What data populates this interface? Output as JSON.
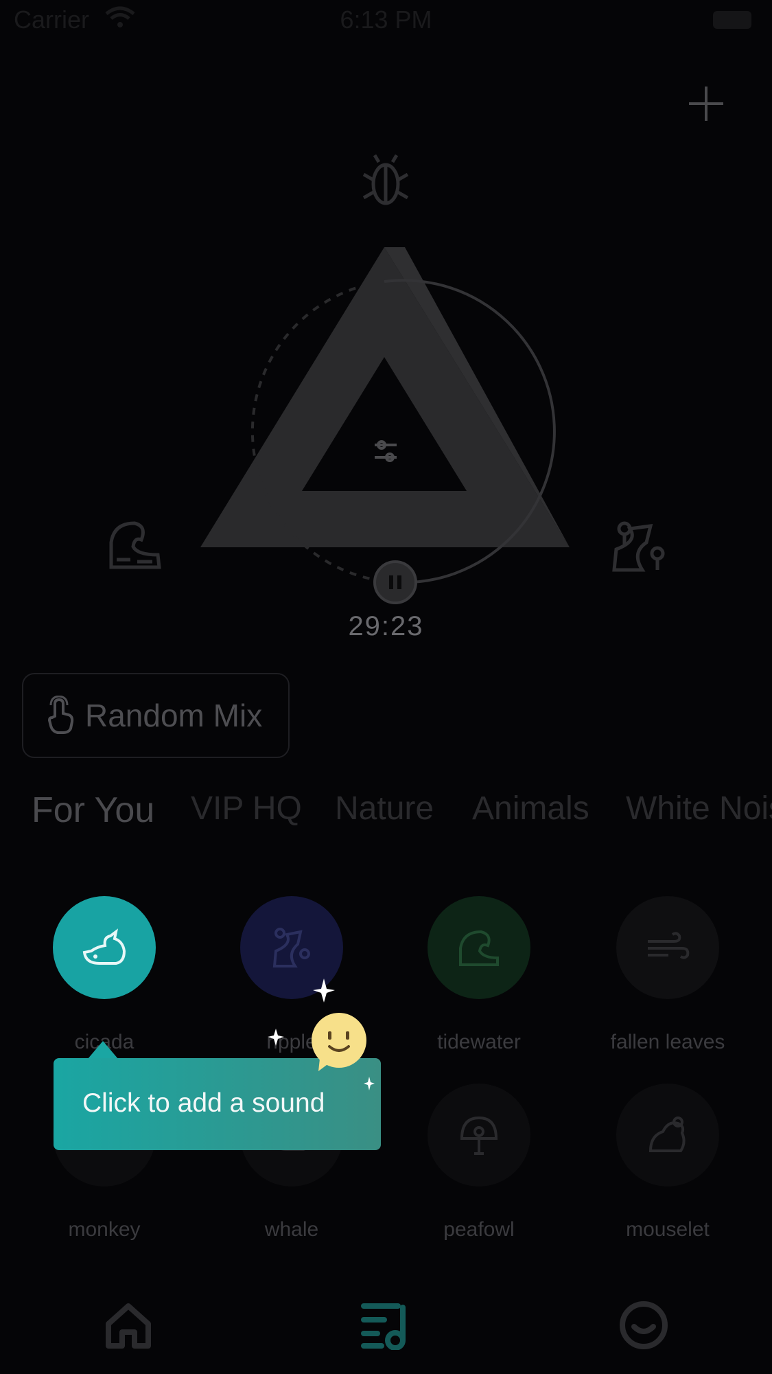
{
  "status_bar": {
    "carrier": "Carrier",
    "time": "6:13 PM"
  },
  "player": {
    "timer": "29:23"
  },
  "random_mix": {
    "label": "Random Mix"
  },
  "tabs": [
    {
      "label": "For You",
      "active": true
    },
    {
      "label": "VIP HQ"
    },
    {
      "label": "Nature"
    },
    {
      "label": "Animals"
    },
    {
      "label": "White Nois"
    }
  ],
  "sounds_row1": [
    {
      "label": "cicada",
      "icon": "whale-icon",
      "color": "#18a3a3"
    },
    {
      "label": "ripple",
      "icon": "ripple-icon",
      "color": "#14163a"
    },
    {
      "label": "tidewater",
      "icon": "wave-icon",
      "color": "#0d2416"
    },
    {
      "label": "fallen leaves",
      "icon": "wind-icon",
      "color": "#0f0f11"
    }
  ],
  "sounds_row2": [
    {
      "label": "monkey",
      "icon": "monkey-icon"
    },
    {
      "label": "whale",
      "icon": "whale-icon"
    },
    {
      "label": "peafowl",
      "icon": "peafowl-icon"
    },
    {
      "label": "mouselet",
      "icon": "mouse-icon"
    }
  ],
  "tooltip": {
    "text": "Click to add a sound"
  },
  "colors": {
    "accent": "#18a3a3",
    "background": "#050507"
  }
}
